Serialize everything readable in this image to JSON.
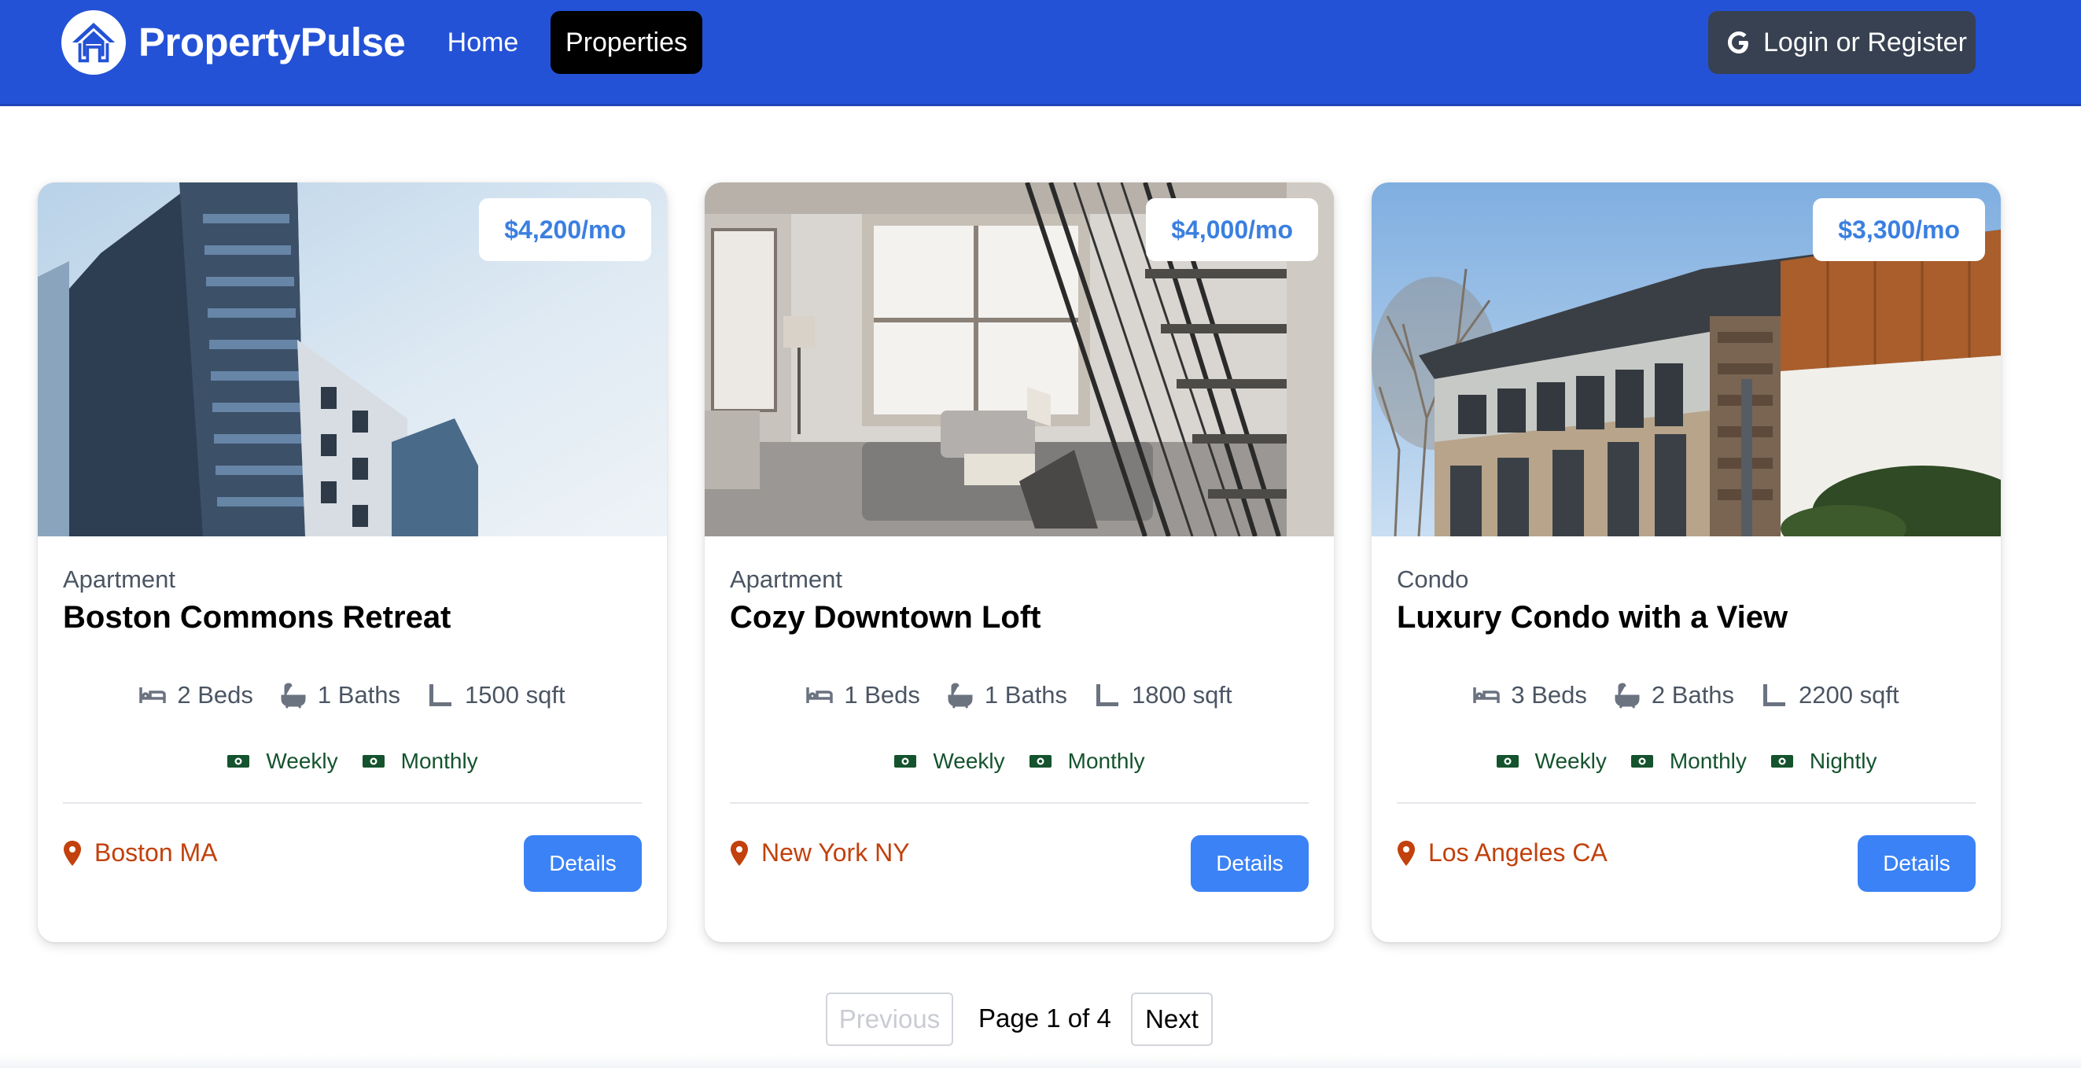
{
  "nav": {
    "brand": "PropertyPulse",
    "links": [
      "Home",
      "Properties"
    ],
    "active": "Properties",
    "login_label": "Login or Register"
  },
  "properties": [
    {
      "price": "$4,200/mo",
      "type": "Apartment",
      "title": "Boston Commons Retreat",
      "beds": "2 Beds",
      "baths": "1 Baths",
      "sqft": "1500 sqft",
      "rates": [
        "Weekly",
        "Monthly"
      ],
      "location": "Boston MA",
      "details_label": "Details"
    },
    {
      "price": "$4,000/mo",
      "type": "Apartment",
      "title": "Cozy Downtown Loft",
      "beds": "1 Beds",
      "baths": "1 Baths",
      "sqft": "1800 sqft",
      "rates": [
        "Weekly",
        "Monthly"
      ],
      "location": "New York NY",
      "details_label": "Details"
    },
    {
      "price": "$3,300/mo",
      "type": "Condo",
      "title": "Luxury Condo with a View",
      "beds": "3 Beds",
      "baths": "2 Baths",
      "sqft": "2200 sqft",
      "rates": [
        "Weekly",
        "Monthly",
        "Nightly"
      ],
      "location": "Los Angeles CA",
      "details_label": "Details"
    }
  ],
  "pagination": {
    "previous_label": "Previous",
    "info": "Page 1 of 4",
    "next_label": "Next"
  },
  "icons": {
    "logo": "house-icon",
    "login": "google-icon",
    "beds": "bed-icon",
    "baths": "bath-icon",
    "sqft": "ruler-icon",
    "rate": "money-bill-icon",
    "location": "map-marker-icon"
  },
  "colors": {
    "navbar": "#2452d6",
    "active_nav": "#000000",
    "login_button": "#374151",
    "price": "#3b7fe0",
    "details_button": "#3b82f6",
    "location": "#c2410c",
    "rates": "#14532d"
  }
}
